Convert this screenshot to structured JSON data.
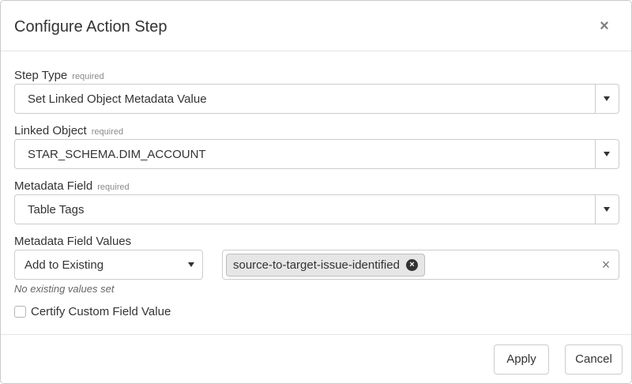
{
  "dialog": {
    "title": "Configure Action Step",
    "close_glyph": "×"
  },
  "fields": {
    "step_type": {
      "label": "Step Type",
      "required_text": "required",
      "value": "Set Linked Object Metadata Value"
    },
    "linked_object": {
      "label": "Linked Object",
      "required_text": "required",
      "value": "STAR_SCHEMA.DIM_ACCOUNT"
    },
    "metadata_field": {
      "label": "Metadata Field",
      "required_text": "required",
      "value": "Table Tags"
    },
    "metadata_field_values": {
      "label": "Metadata Field Values",
      "mode": "Add to Existing",
      "tags": [
        "source-to-target-issue-identified"
      ],
      "tag_remove_glyph": "×",
      "clear_glyph": "×",
      "hint": "No existing values set"
    },
    "certify": {
      "label": "Certify Custom Field Value",
      "checked": false
    }
  },
  "footer": {
    "apply_label": "Apply",
    "cancel_label": "Cancel"
  },
  "icons": {
    "close": "close-icon",
    "caret": "chevron-down-icon",
    "tag_remove": "remove-tag-icon",
    "clear": "clear-icon"
  }
}
